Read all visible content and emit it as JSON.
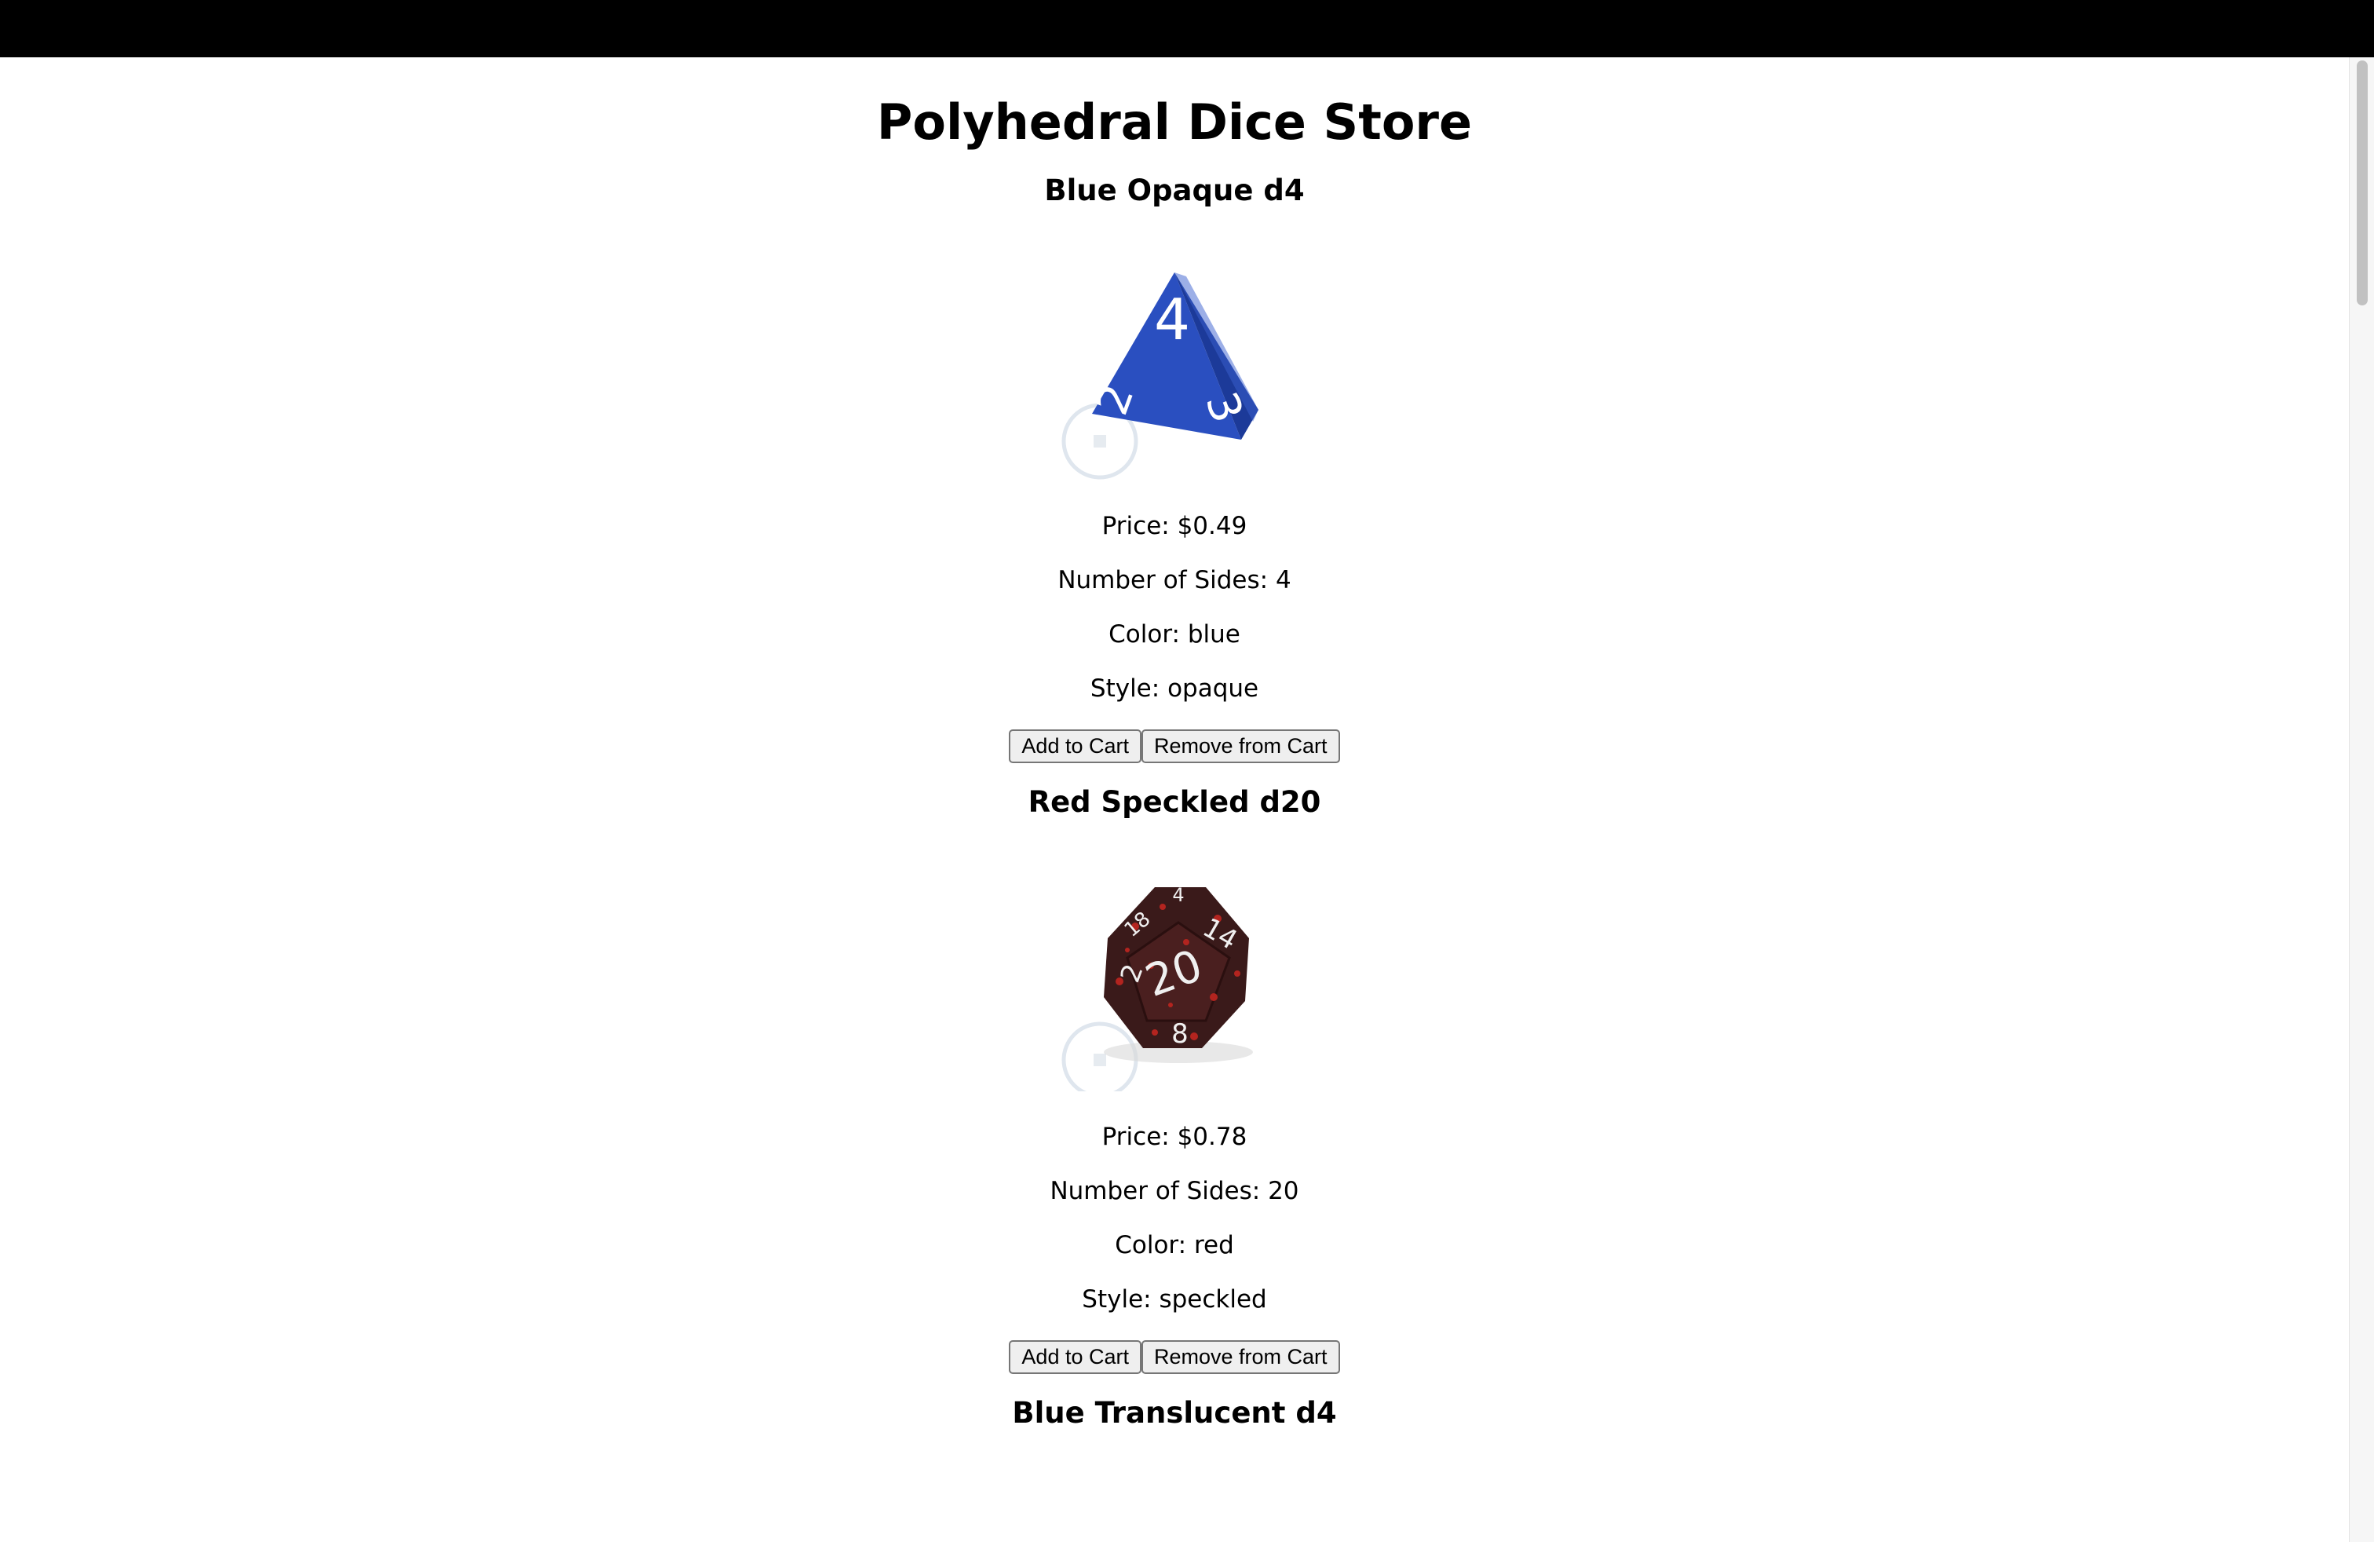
{
  "store": {
    "title": "Polyhedral Dice Store"
  },
  "labels": {
    "price": "Price: ",
    "sides": "Number of Sides: ",
    "color": "Color: ",
    "style": "Style: "
  },
  "buttons": {
    "add": "Add to Cart",
    "remove": "Remove from Cart"
  },
  "products": [
    {
      "name": "Blue Opaque d4",
      "price": "$0.49",
      "sides": "4",
      "color": "blue",
      "style": "opaque",
      "image": "blue-d4-die-icon",
      "die_color": "#2a4fc0",
      "faces": [
        "4",
        "2",
        "3"
      ]
    },
    {
      "name": "Red Speckled d20",
      "price": "$0.78",
      "sides": "20",
      "color": "red",
      "style": "speckled",
      "image": "red-speckled-d20-die-icon",
      "die_color": "#3a1a1a",
      "faces": [
        "20",
        "14",
        "2",
        "8",
        "18",
        "4"
      ]
    },
    {
      "name": "Blue Translucent d4"
    }
  ]
}
